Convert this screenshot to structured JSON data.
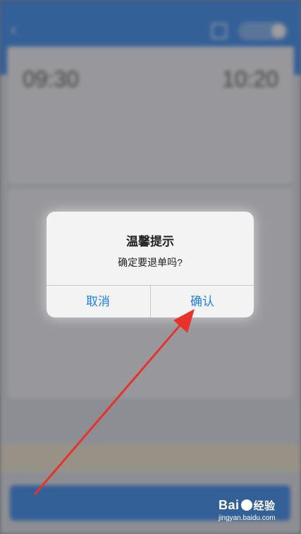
{
  "dialog": {
    "title": "温馨提示",
    "message": "确定要退单吗?",
    "cancel_label": "取消",
    "confirm_label": "确认"
  },
  "background": {
    "trip": {
      "depart_time": "09:30",
      "arrive_time": "10:20"
    }
  },
  "watermark": {
    "brand_left": "Bai",
    "brand_right": "经验",
    "url": "jingyan.baidu.com"
  },
  "colors": {
    "accent": "#3f8ef0",
    "dialog_button": "#1f7fe8",
    "arrow": "#e8322c"
  }
}
